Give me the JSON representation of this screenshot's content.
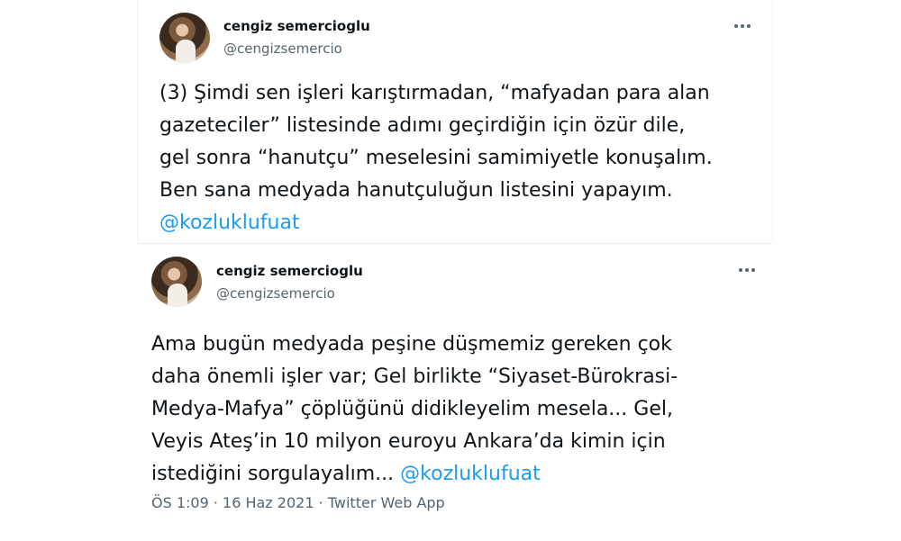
{
  "tweets": [
    {
      "author": {
        "name": "cengiz semercioglu",
        "handle": "@cengizsemercio"
      },
      "text": "(3) Şimdi sen işleri karıştırmadan, “mafyadan para alan\ngazeteciler” listesinde adımı geçirdiğin için özür dile,\ngel sonra “hanutçu” meselesini samimiyetle konuşalım.\nBen sana medyada hanutçuluğun listesini yapayım.",
      "mention": "@kozluklufuat"
    },
    {
      "author": {
        "name": "cengiz semercioglu",
        "handle": "@cengizsemercio"
      },
      "text": "Ama bugün medyada peşine düşmemiz gereken çok\ndaha önemli işler var; Gel birlikte “Siyaset-Bürokrasi-\nMedya-Mafya” çöplüğünü didikleyelim mesela...  Gel,\nVeyis Ateş’in 10 milyon euroyu Ankara’da kimin için\nistediğini sorgulayalım... ",
      "mention": "@kozluklufuat",
      "timestamp": "ÖS 1:09 · 16 Haz 2021 · Twitter Web App"
    }
  ],
  "colors": {
    "mention": "#1d9bf0",
    "secondary_text": "#536471",
    "primary_text": "#0f1419"
  },
  "icons": {
    "more": "more-horizontal-icon"
  }
}
